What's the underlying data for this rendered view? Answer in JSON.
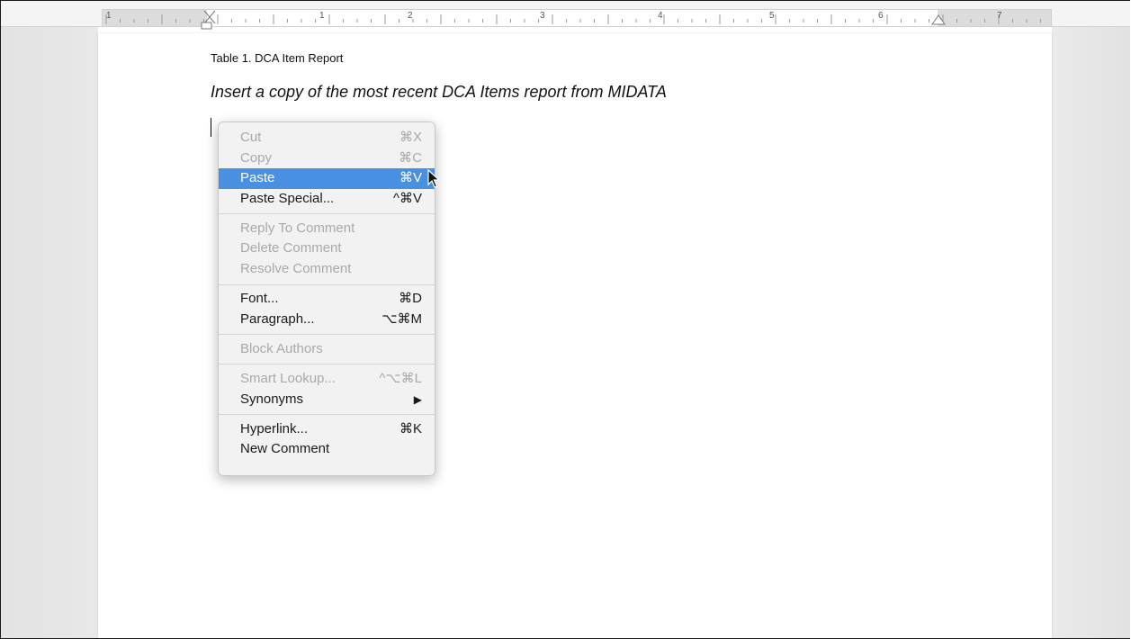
{
  "ruler": {
    "numbers": [
      "1",
      "1",
      "2",
      "3",
      "4",
      "5",
      "6",
      "7"
    ]
  },
  "document": {
    "caption": "Table 1. DCA Item Report",
    "instruction": "Insert a copy of the most recent DCA Items report from MIDATA"
  },
  "context_menu": {
    "groups": [
      [
        {
          "label": "Cut",
          "shortcut": "⌘X",
          "enabled": false,
          "highlighted": false
        },
        {
          "label": "Copy",
          "shortcut": "⌘C",
          "enabled": false,
          "highlighted": false
        },
        {
          "label": "Paste",
          "shortcut": "⌘V",
          "enabled": true,
          "highlighted": true
        },
        {
          "label": "Paste Special...",
          "shortcut": "^⌘V",
          "enabled": true,
          "highlighted": false
        }
      ],
      [
        {
          "label": "Reply To Comment",
          "shortcut": "",
          "enabled": false,
          "highlighted": false
        },
        {
          "label": "Delete Comment",
          "shortcut": "",
          "enabled": false,
          "highlighted": false
        },
        {
          "label": "Resolve Comment",
          "shortcut": "",
          "enabled": false,
          "highlighted": false
        }
      ],
      [
        {
          "label": "Font...",
          "shortcut": "⌘D",
          "enabled": true,
          "highlighted": false
        },
        {
          "label": "Paragraph...",
          "shortcut": "⌥⌘M",
          "enabled": true,
          "highlighted": false
        }
      ],
      [
        {
          "label": "Block Authors",
          "shortcut": "",
          "enabled": false,
          "highlighted": false
        }
      ],
      [
        {
          "label": "Smart Lookup...",
          "shortcut": "^⌥⌘L",
          "enabled": false,
          "highlighted": false
        },
        {
          "label": "Synonyms",
          "shortcut": "▶",
          "enabled": true,
          "highlighted": false
        }
      ],
      [
        {
          "label": "Hyperlink...",
          "shortcut": "⌘K",
          "enabled": true,
          "highlighted": false
        },
        {
          "label": "New Comment",
          "shortcut": "",
          "enabled": true,
          "highlighted": false
        }
      ]
    ]
  },
  "colors": {
    "highlight": "#4a90e2",
    "disabled_text": "#a9a9a9"
  }
}
